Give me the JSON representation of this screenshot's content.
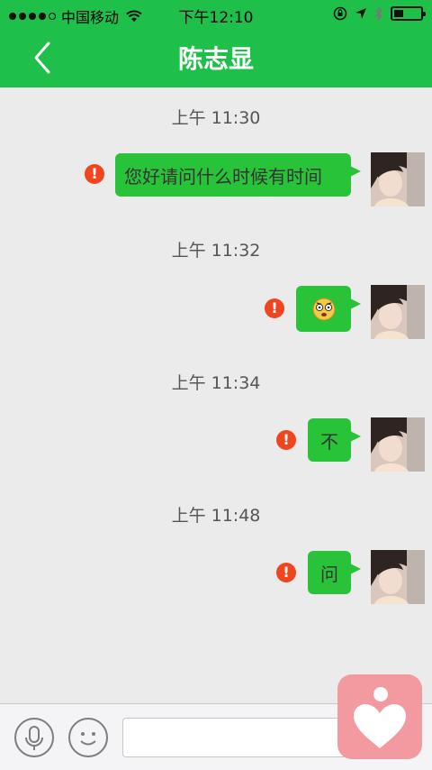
{
  "status_bar": {
    "carrier": "中国移动",
    "time": "下午12:10"
  },
  "header": {
    "title": "陈志显"
  },
  "messages": [
    {
      "time": "上午 11:30",
      "text": "您好请问什么时候有时间",
      "status": "failed"
    },
    {
      "time": "上午 11:32",
      "text": "",
      "emoji": "dizzy-face-emoji",
      "status": "failed"
    },
    {
      "time": "上午 11:34",
      "text": "不",
      "status": "failed"
    },
    {
      "time": "上午 11:48",
      "text": "问",
      "status": "failed"
    }
  ],
  "input_bar": {
    "voice_icon": "microphone-icon",
    "emoji_icon": "smiley-icon",
    "input_value": ""
  },
  "colors": {
    "accent": "#1fc04a",
    "bubble": "#29c33a",
    "error": "#f0461f",
    "background": "#ebebeb"
  }
}
